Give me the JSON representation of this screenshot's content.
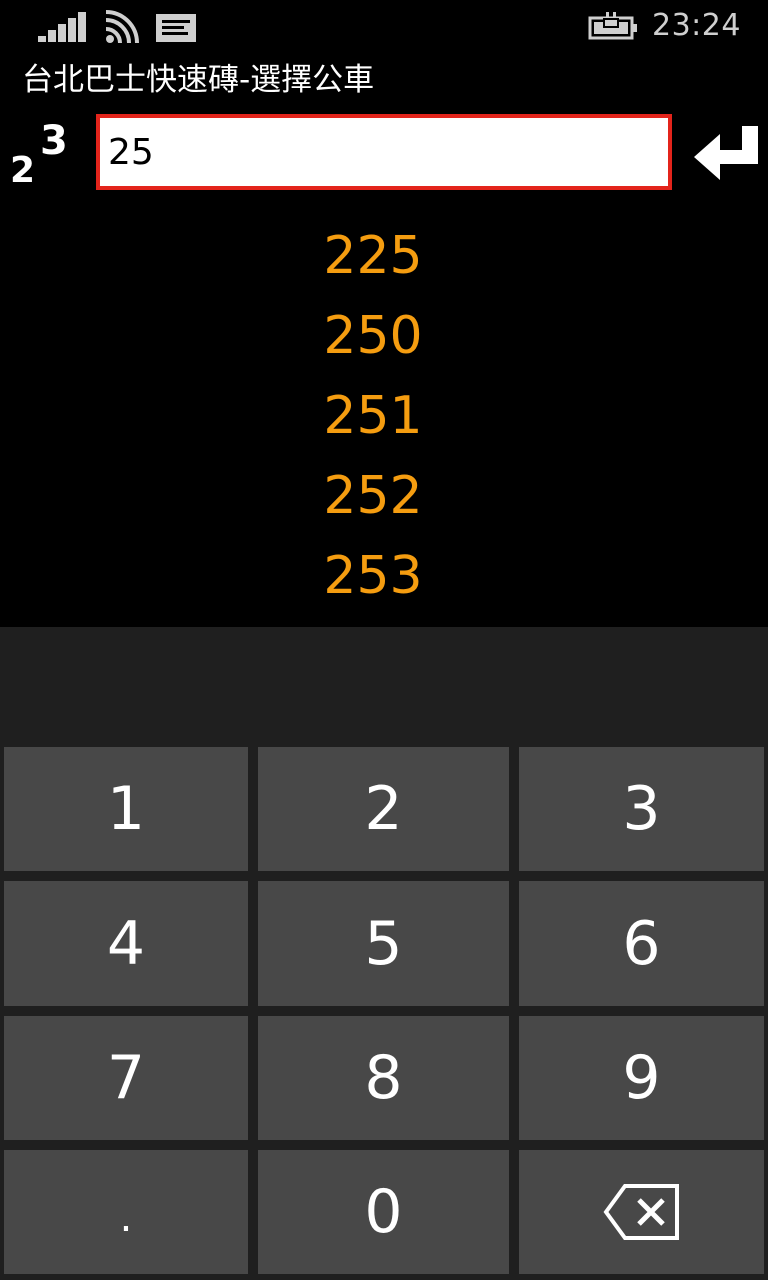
{
  "status_bar": {
    "time": "23:24",
    "icons": [
      "signal-strength-icon",
      "wifi-icon",
      "message-icon",
      "battery-charging-icon"
    ]
  },
  "app": {
    "title": "台北巴士快速磚-選擇公車"
  },
  "search": {
    "value": "25"
  },
  "suggestions": [
    "225",
    "250",
    "251",
    "252",
    "253"
  ],
  "keypad": {
    "k1": "1",
    "k2": "2",
    "k3": "3",
    "k4": "4",
    "k5": "5",
    "k6": "6",
    "k7": "7",
    "k8": "8",
    "k9": "9",
    "dot": ".",
    "k0": "0",
    "backspace_icon": "backspace-icon"
  },
  "colors": {
    "accent": "#f59d10",
    "input_border": "#e3241b",
    "key_background": "#484848",
    "keyboard_background": "#1f1f1f"
  }
}
